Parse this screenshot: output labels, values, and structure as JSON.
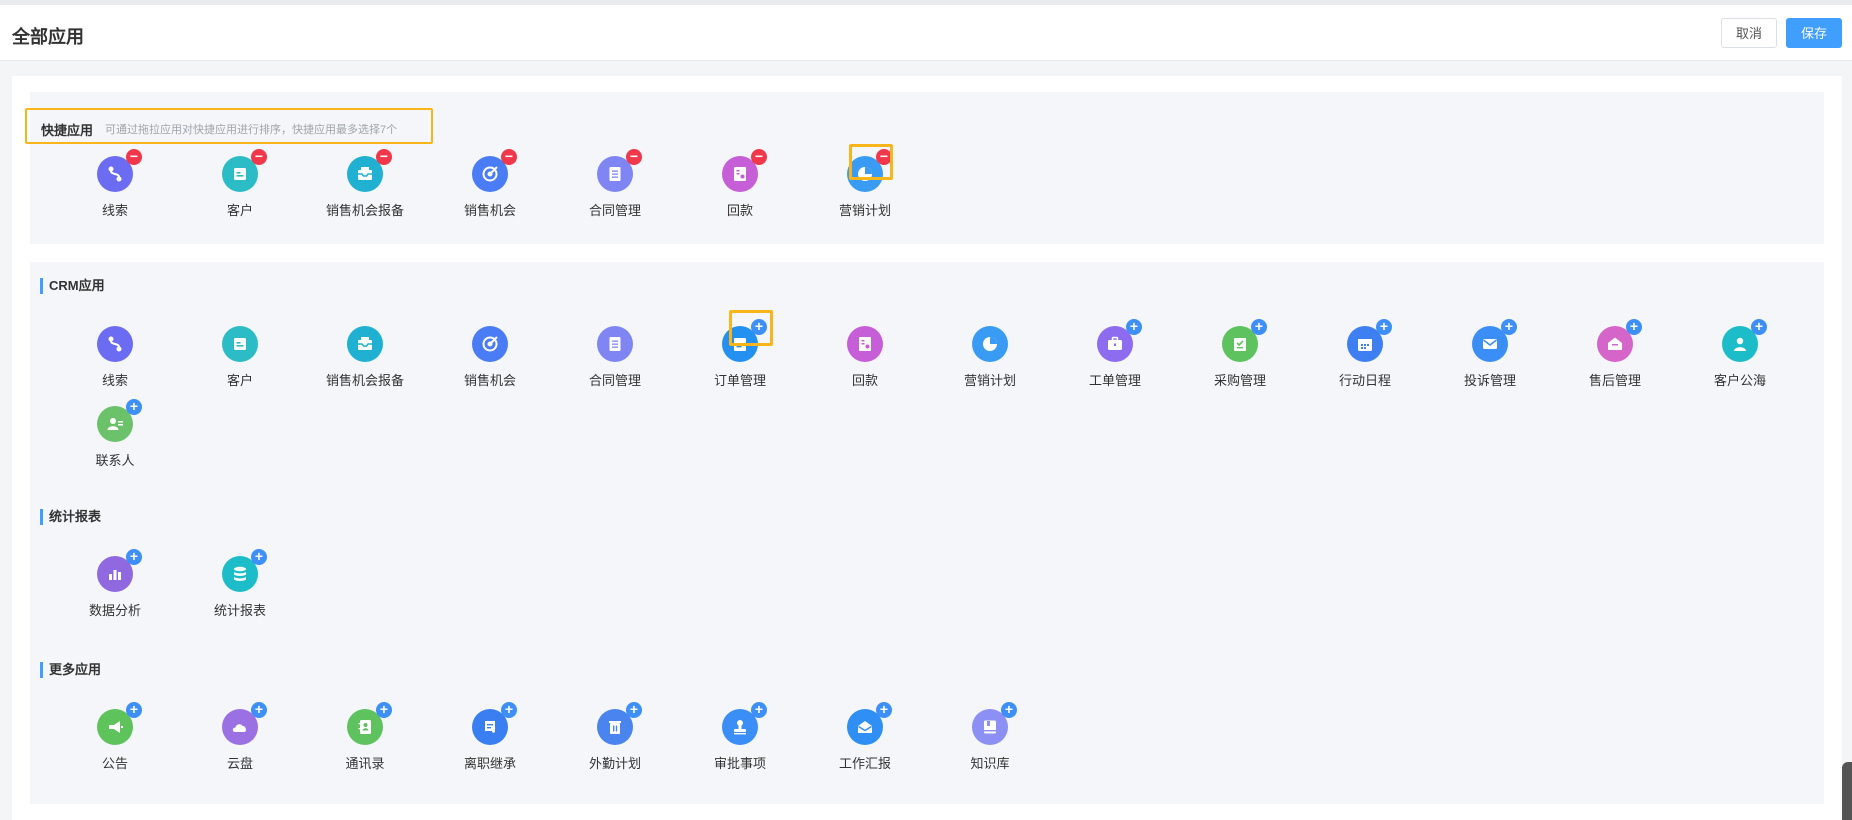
{
  "header": {
    "title": "全部应用",
    "cancel_label": "取消",
    "save_label": "保存"
  },
  "quick": {
    "title": "快捷应用",
    "hint": "可通过拖拉应用对快捷应用进行排序，快捷应用最多选择7个",
    "apps": [
      {
        "label": "线索",
        "icon": "route-icon",
        "color": "#6c6cf3",
        "action": "−"
      },
      {
        "label": "客户",
        "icon": "customer-card-icon",
        "color": "#2bbcc6",
        "action": "−"
      },
      {
        "label": "销售机会报备",
        "icon": "inbox-icon",
        "color": "#1fb0d2",
        "action": "−"
      },
      {
        "label": "销售机会",
        "icon": "target-icon",
        "color": "#4a7cf6",
        "action": "−"
      },
      {
        "label": "合同管理",
        "icon": "document-icon",
        "color": "#7f86f3",
        "action": "−"
      },
      {
        "label": "回款",
        "icon": "receipt-icon",
        "color": "#c65ed8",
        "action": "−"
      },
      {
        "label": "营销计划",
        "icon": "pie-chart-icon",
        "color": "#3a9bf5",
        "action": "−"
      }
    ]
  },
  "crm": {
    "title": "CRM应用",
    "apps": [
      {
        "label": "线索",
        "icon": "route-icon",
        "color": "#6c6cf3",
        "action": ""
      },
      {
        "label": "客户",
        "icon": "customer-card-icon",
        "color": "#2bbcc6",
        "action": ""
      },
      {
        "label": "销售机会报备",
        "icon": "inbox-icon",
        "color": "#1fb0d2",
        "action": ""
      },
      {
        "label": "销售机会",
        "icon": "target-icon",
        "color": "#4a7cf6",
        "action": ""
      },
      {
        "label": "合同管理",
        "icon": "document-icon",
        "color": "#7f86f3",
        "action": ""
      },
      {
        "label": "订单管理",
        "icon": "order-icon",
        "color": "#2490f0",
        "action": "+"
      },
      {
        "label": "回款",
        "icon": "receipt-icon",
        "color": "#c65ed8",
        "action": ""
      },
      {
        "label": "营销计划",
        "icon": "pie-chart-icon",
        "color": "#3a9bf5",
        "action": ""
      },
      {
        "label": "工单管理",
        "icon": "briefcase-icon",
        "color": "#8d6cf0",
        "action": "+"
      },
      {
        "label": "采购管理",
        "icon": "clipboard-icon",
        "color": "#5ec35e",
        "action": "+"
      },
      {
        "label": "行动日程",
        "icon": "calendar-icon",
        "color": "#3e7ff2",
        "action": "+"
      },
      {
        "label": "投诉管理",
        "icon": "envelope-icon",
        "color": "#3a8ef5",
        "action": "+"
      },
      {
        "label": "售后管理",
        "icon": "home-icon",
        "color": "#d565c8",
        "action": "+"
      },
      {
        "label": "客户公海",
        "icon": "user-icon",
        "color": "#1cbcc8",
        "action": "+"
      },
      {
        "label": "联系人",
        "icon": "contacts-icon",
        "color": "#6bc26b",
        "action": "+"
      }
    ]
  },
  "stats": {
    "title": "统计报表",
    "apps": [
      {
        "label": "数据分析",
        "icon": "bar-chart-icon",
        "color": "#9068e0",
        "action": "+"
      },
      {
        "label": "统计报表",
        "icon": "database-icon",
        "color": "#1cbcc8",
        "action": "+"
      }
    ]
  },
  "more": {
    "title": "更多应用",
    "apps": [
      {
        "label": "公告",
        "icon": "megaphone-icon",
        "color": "#5fc35c",
        "action": "+"
      },
      {
        "label": "云盘",
        "icon": "cloud-icon",
        "color": "#9a70e3",
        "action": "+"
      },
      {
        "label": "通讯录",
        "icon": "address-book-icon",
        "color": "#5ec35e",
        "action": "+"
      },
      {
        "label": "离职继承",
        "icon": "scroll-icon",
        "color": "#3a7ff2",
        "action": "+"
      },
      {
        "label": "外勤计划",
        "icon": "trash-icon",
        "color": "#4a84ee",
        "action": "+"
      },
      {
        "label": "审批事项",
        "icon": "stamp-icon",
        "color": "#3a8ef5",
        "action": "+"
      },
      {
        "label": "工作汇报",
        "icon": "mail-open-icon",
        "color": "#2f8ff5",
        "action": "+"
      },
      {
        "label": "知识库",
        "icon": "book-icon",
        "color": "#8c8ff3",
        "action": "+"
      }
    ]
  }
}
